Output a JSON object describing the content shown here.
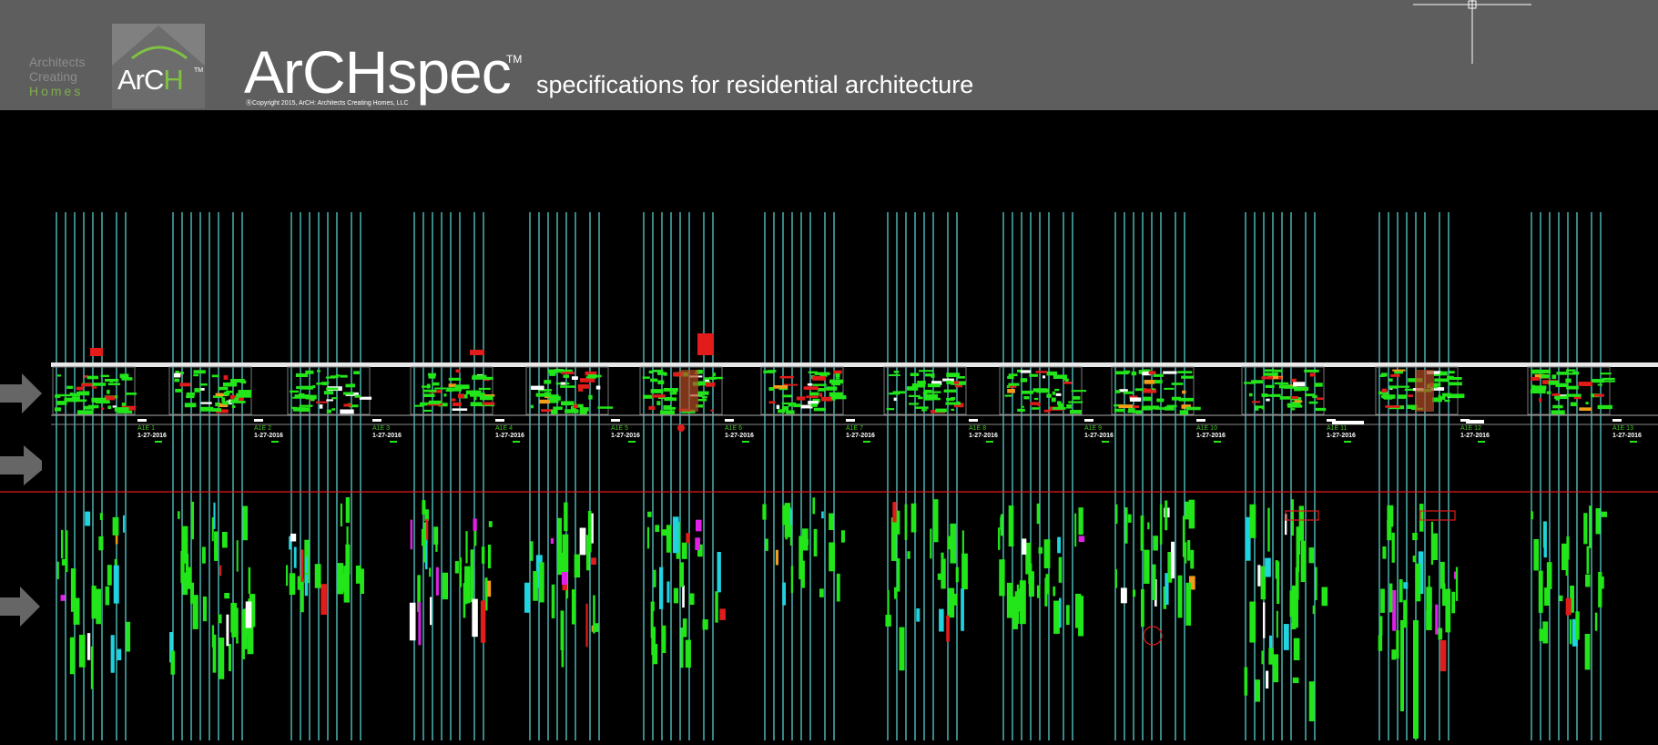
{
  "header": {
    "brand_lines": [
      "Architects",
      "Creating",
      "Homes"
    ],
    "logo_prefix": "ArC",
    "logo_highlight": "H",
    "logo_tm": "TM",
    "app_title": "ArCHspec",
    "app_title_tm": "TM",
    "subtitle": "specifications for residential architecture",
    "copyright": "Copyright 2015, ArCH: Architects Creating Homes, LLC"
  },
  "canvas": {
    "sheets": [
      {
        "label": "A1E 1",
        "date": "1-27-2016"
      },
      {
        "label": "A1E 2",
        "date": "1-27-2016"
      },
      {
        "label": "A1E 3",
        "date": "1-27-2016"
      },
      {
        "label": "A1E 4",
        "date": "1-27-2016"
      },
      {
        "label": "A1E 5",
        "date": "1-27-2016"
      },
      {
        "label": "A1E 6",
        "date": "1-27-2016"
      },
      {
        "label": "A1E 7",
        "date": "1-27-2016"
      },
      {
        "label": "A1E 8",
        "date": "1-27-2016"
      },
      {
        "label": "A1E 9",
        "date": "1-27-2016"
      },
      {
        "label": "A1E 10",
        "date": "1-27-2016"
      },
      {
        "label": "A1E 11",
        "date": "1-27-2016"
      },
      {
        "label": "A1E 12",
        "date": "1-27-2016"
      },
      {
        "label": "A1E 13",
        "date": "1-27-2016"
      }
    ],
    "colors": {
      "background": "#000000",
      "guide_line": "#5fdede",
      "content": "#22e619",
      "markup": "#e21b1b",
      "highlight": "#20d3e0",
      "accent_orange": "#f39b1b",
      "accent_magenta": "#e020e8",
      "header": "#5e5e5e"
    },
    "arrows": [
      "arrow-icon",
      "arrow-icon",
      "arrow-icon"
    ]
  }
}
